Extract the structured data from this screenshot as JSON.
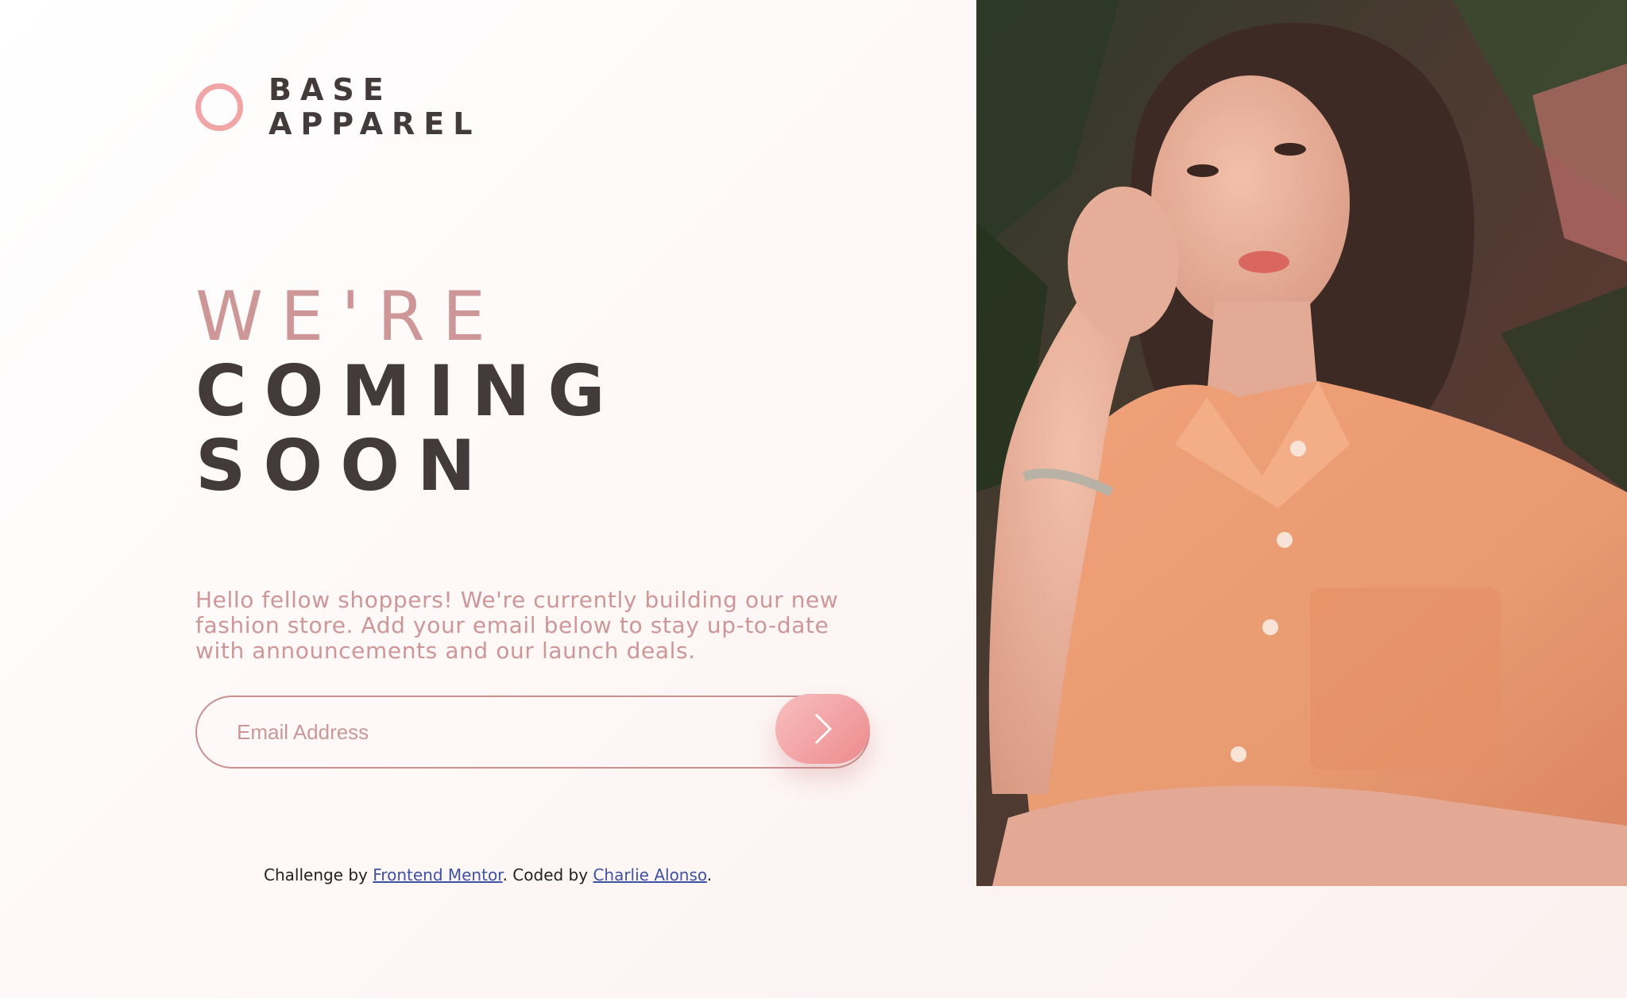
{
  "brand": {
    "line1": "BASE",
    "line2": "APPAREL"
  },
  "headline": {
    "line1": "WE'RE",
    "line2": "COMING",
    "line3": "SOON"
  },
  "description": "Hello fellow shoppers! We're currently building our new fashion store. Add your email below to stay up-to-date with announcements and our launch deals.",
  "form": {
    "email_placeholder": "Email Address",
    "submit_icon": "arrow-icon"
  },
  "footer": {
    "prefix": "Challenge by ",
    "link1": "Frontend Mentor",
    "middle": ". Coded by ",
    "link2": "Charlie Alonso",
    "suffix": "."
  },
  "colors": {
    "accent_pink": "#f1a5a6",
    "desaturated_red": "#ce9797",
    "dark_grayish_red": "#423a3b",
    "link_blue": "#3e52a3"
  }
}
